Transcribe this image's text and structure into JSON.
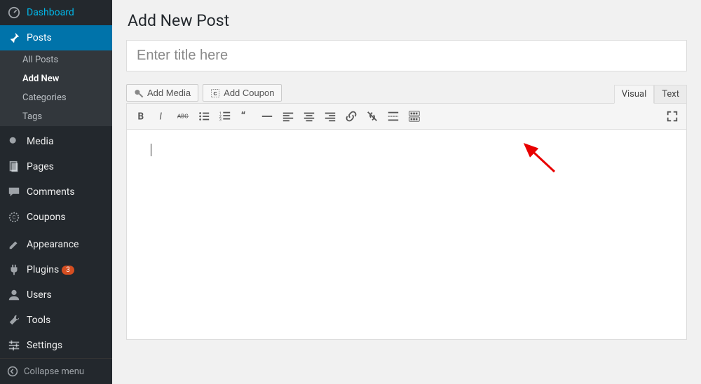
{
  "sidebar": {
    "dashboard": "Dashboard",
    "posts": "Posts",
    "posts_sub": {
      "all": "All Posts",
      "addnew": "Add New",
      "categories": "Categories",
      "tags": "Tags"
    },
    "media": "Media",
    "pages": "Pages",
    "comments": "Comments",
    "coupons": "Coupons",
    "appearance": "Appearance",
    "plugins": "Plugins",
    "plugins_badge": "3",
    "users": "Users",
    "tools": "Tools",
    "settings": "Settings",
    "collapse": "Collapse menu"
  },
  "page": {
    "title": "Add New Post",
    "title_placeholder": "Enter title here"
  },
  "buttons": {
    "add_media": "Add Media",
    "add_coupon": "Add Coupon"
  },
  "tabs": {
    "visual": "Visual",
    "text": "Text"
  },
  "toolbar_icons": [
    "bold-icon",
    "italic-icon",
    "strikethrough-icon",
    "bullet-list-icon",
    "number-list-icon",
    "blockquote-icon",
    "hr-icon",
    "align-left-icon",
    "align-center-icon",
    "align-right-icon",
    "link-icon",
    "unlink-icon",
    "readmore-icon",
    "toolbar-toggle-icon"
  ]
}
